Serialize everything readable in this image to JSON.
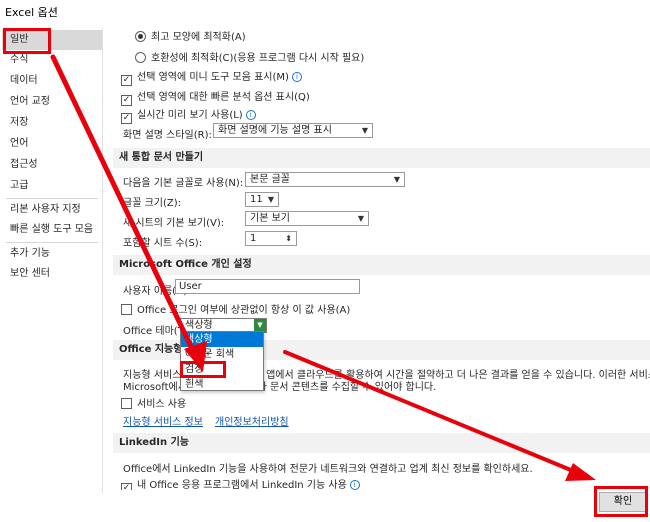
{
  "window": {
    "title": "Excel 옵션"
  },
  "nav": {
    "items": [
      {
        "label": "일반"
      },
      {
        "label": "수식"
      },
      {
        "label": "데이터"
      },
      {
        "label": "언어 교정"
      },
      {
        "label": "저장"
      },
      {
        "label": "언어"
      },
      {
        "label": "접근성"
      },
      {
        "label": "고급"
      },
      {
        "label": "리본 사용자 지정"
      },
      {
        "label": "빠른 실행 도구 모음"
      },
      {
        "label": "추가 기능"
      },
      {
        "label": "보안 센터"
      }
    ],
    "selected_index": 0
  },
  "ui_options": {
    "radio_best_appearance": "최고 모양에 최적화(A)",
    "radio_compat": "호환성에 최적화(C)(응용 프로그램 다시 시작 필요)",
    "mini_toolbar": "선택 영역에 미니 도구 모음 표시(M)",
    "quick_analysis": "선택 영역에 대한 빠른 분석 옵션 표시(Q)",
    "live_preview": "실시간 미리 보기 사용(L)",
    "screentip_label": "화면 설명 스타일(R):",
    "screentip_value": "화면 설명에 기능 설명 표시"
  },
  "new_workbook": {
    "header": "새 통합 문서 만들기",
    "font_label": "다음을 기본 글꼴로 사용(N):",
    "font_value": "본문 글꼴",
    "size_label": "글꼴 크기(Z):",
    "size_value": "11",
    "view_label": "새 시트의 기본 보기(V):",
    "view_value": "기본 보기",
    "sheets_label": "포함할 시트 수(S):",
    "sheets_value": "1"
  },
  "personalize": {
    "header": "Microsoft Office 개인 설정",
    "username_label": "사용자 이름(U):",
    "username_value": "User",
    "always_use": "Office 로그인 여부에 상관없이 항상 이 값 사용(A)",
    "theme_label": "Office 테마(T):",
    "theme_value": "색상형",
    "theme_options": [
      "색상형",
      "어두운 회색",
      "검정",
      "흰색"
    ]
  },
  "intelligent": {
    "header": "Office 지능형 서비스",
    "desc_line1": "지능형 서비스를 사용하면 Office 앱에서 클라우드를 활용하여 시간을 절약하고 더 나은 결과를 얻을 수 있습니다. 이러한 서비스를 제",
    "desc_line2": "Microsoft에서 사용자의 검색어와 문서 콘텐츠를 수집할 수 있어야 합니다.",
    "enable": "서비스 사용",
    "link_about": "지능형 서비스 정보",
    "link_privacy": "개인정보처리방침"
  },
  "linkedin": {
    "header": "LinkedIn 기능",
    "desc": "Office에서 LinkedIn 기능을 사용하여 전문가 네트워크와 연결하고 업계 최신 정보를 확인하세요.",
    "enable": "내 Office 응용 프로그램에서 LinkedIn 기능 사용"
  },
  "footer": {
    "ok_label": "확인"
  },
  "colors": {
    "highlight": "#e8000b",
    "selection": "#0078d7",
    "link": "#1155aa"
  }
}
